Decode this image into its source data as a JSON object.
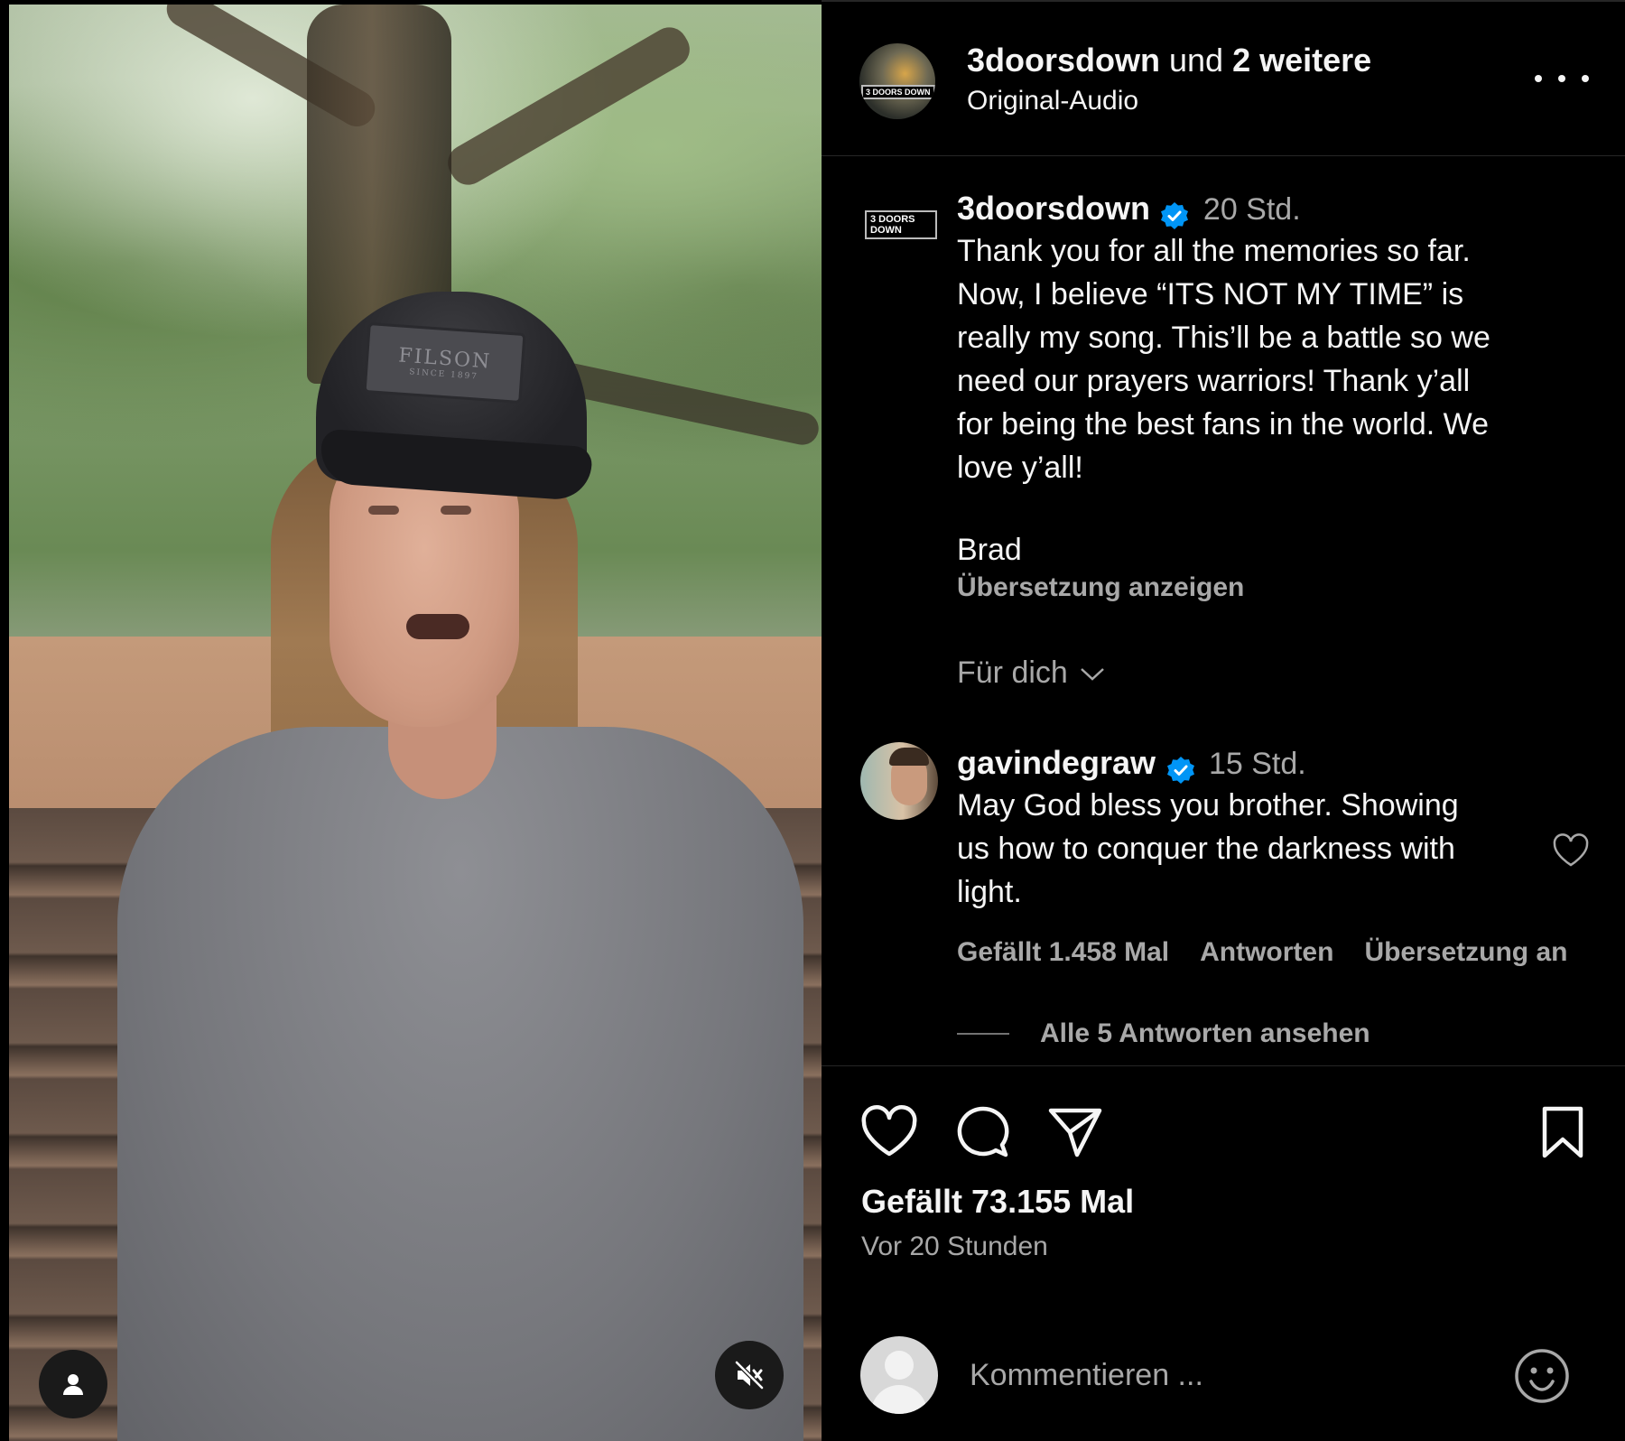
{
  "header": {
    "author": "3doorsdown",
    "joiner": "und",
    "others": "2 weitere",
    "audio": "Original-Audio",
    "logo_text": "3 DOORS DOWN"
  },
  "caption": {
    "username": "3doorsdown",
    "time": "20 Std.",
    "text": "Thank you for all the memories so far.\nNow, I believe “ITS NOT MY TIME” is\nreally my song. This’ll be a battle so we\nneed our prayers warriors! Thank y’all\nfor being the best fans in the world. We\nlove y’all!",
    "signature": "Brad",
    "translate_label": "Übersetzung anzeigen"
  },
  "sort": {
    "label": "Für dich"
  },
  "comment": {
    "username": "gavindegraw",
    "time": "15 Std.",
    "text": "May God bless you brother. Showing\nus how to conquer the darkness with\nlight.",
    "likes": "Gefällt 1.458 Mal",
    "reply": "Antworten",
    "translate": "Übersetzung an",
    "view_replies": "Alle 5 Antworten ansehen"
  },
  "post": {
    "likes": "Gefällt 73.155 Mal",
    "time_ago": "Vor 20 Stunden"
  },
  "composer": {
    "placeholder": "Kommentieren ..."
  },
  "video": {
    "cap_brand": "FILSON",
    "cap_since": "SINCE 1897"
  },
  "colors": {
    "verified": "#0095f6",
    "muted_text": "#a8a8a8",
    "background": "#000000"
  },
  "icons": [
    "user-icon",
    "mute-icon",
    "more-icon",
    "verified-icon",
    "chevron-down-icon",
    "heart-icon",
    "comment-icon",
    "share-icon",
    "bookmark-icon",
    "emoji-icon"
  ]
}
